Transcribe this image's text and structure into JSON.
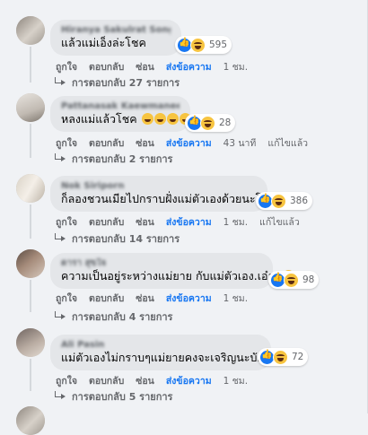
{
  "comments": [
    {
      "author": "Hiranya Sakulrat Songkhran",
      "text": "แล้วแม่เอ็งล่ะโชค",
      "reaction_count": "595",
      "actions": {
        "like": "ถูกใจ",
        "reply": "ตอบกลับ",
        "hide": "ซ่อน",
        "share": "ส่งข้อความ",
        "time": "1 ชม.",
        "edited": ""
      },
      "replies": "การตอบกลับ 27 รายการ"
    },
    {
      "author": "Pattanasak Kaewmanee ปรีดา",
      "text": "หลงแม่แล้วโชค",
      "reaction_count": "28",
      "actions": {
        "like": "ถูกใจ",
        "reply": "ตอบกลับ",
        "hide": "ซ่อน",
        "share": "ส่งข้อความ",
        "time": "43 นาที",
        "edited": "แก้ไขแล้ว"
      },
      "replies": "การตอบกลับ 2 รายการ"
    },
    {
      "author": "Nok Siriporn",
      "text": "ก็ลองชวนเมียไปกราบฝั่งแม่ตัวเองด้วยนะโชค",
      "reaction_count": "386",
      "actions": {
        "like": "ถูกใจ",
        "reply": "ตอบกลับ",
        "hide": "ซ่อน",
        "share": "ส่งข้อความ",
        "time": "1 ชม.",
        "edited": "แก้ไขแล้ว"
      },
      "replies": "การตอบกลับ 14 รายการ"
    },
    {
      "author": "ดารา สุขใจ",
      "text": "ความเป็นอยู่ระหว่างแม่ยาย กับแม่ตัวเอง.เอ๋อ..",
      "reaction_count": "98",
      "actions": {
        "like": "ถูกใจ",
        "reply": "ตอบกลับ",
        "hide": "ซ่อน",
        "share": "ส่งข้อความ",
        "time": "1 ชม.",
        "edited": ""
      },
      "replies": "การตอบกลับ 4 รายการ"
    },
    {
      "author": "Ali Pasin",
      "text": "แม่ตัวเองไม่กราบๆแม่ยายคงจะเจริญนะบักโชค",
      "reaction_count": "72",
      "actions": {
        "like": "ถูกใจ",
        "reply": "ตอบกลับ",
        "hide": "ซ่อน",
        "share": "ส่งข้อความ",
        "time": "1 ชม.",
        "edited": ""
      },
      "replies": "การตอบกลับ 5 รายการ"
    }
  ],
  "icons": [
    "like-reaction-icon",
    "haha-reaction-icon",
    "reply-arrow-icon"
  ],
  "colors": {
    "accent": "#1877f2",
    "bubble": "#e4e6e9",
    "muted": "#65676b",
    "background": "#f0f2f5"
  }
}
